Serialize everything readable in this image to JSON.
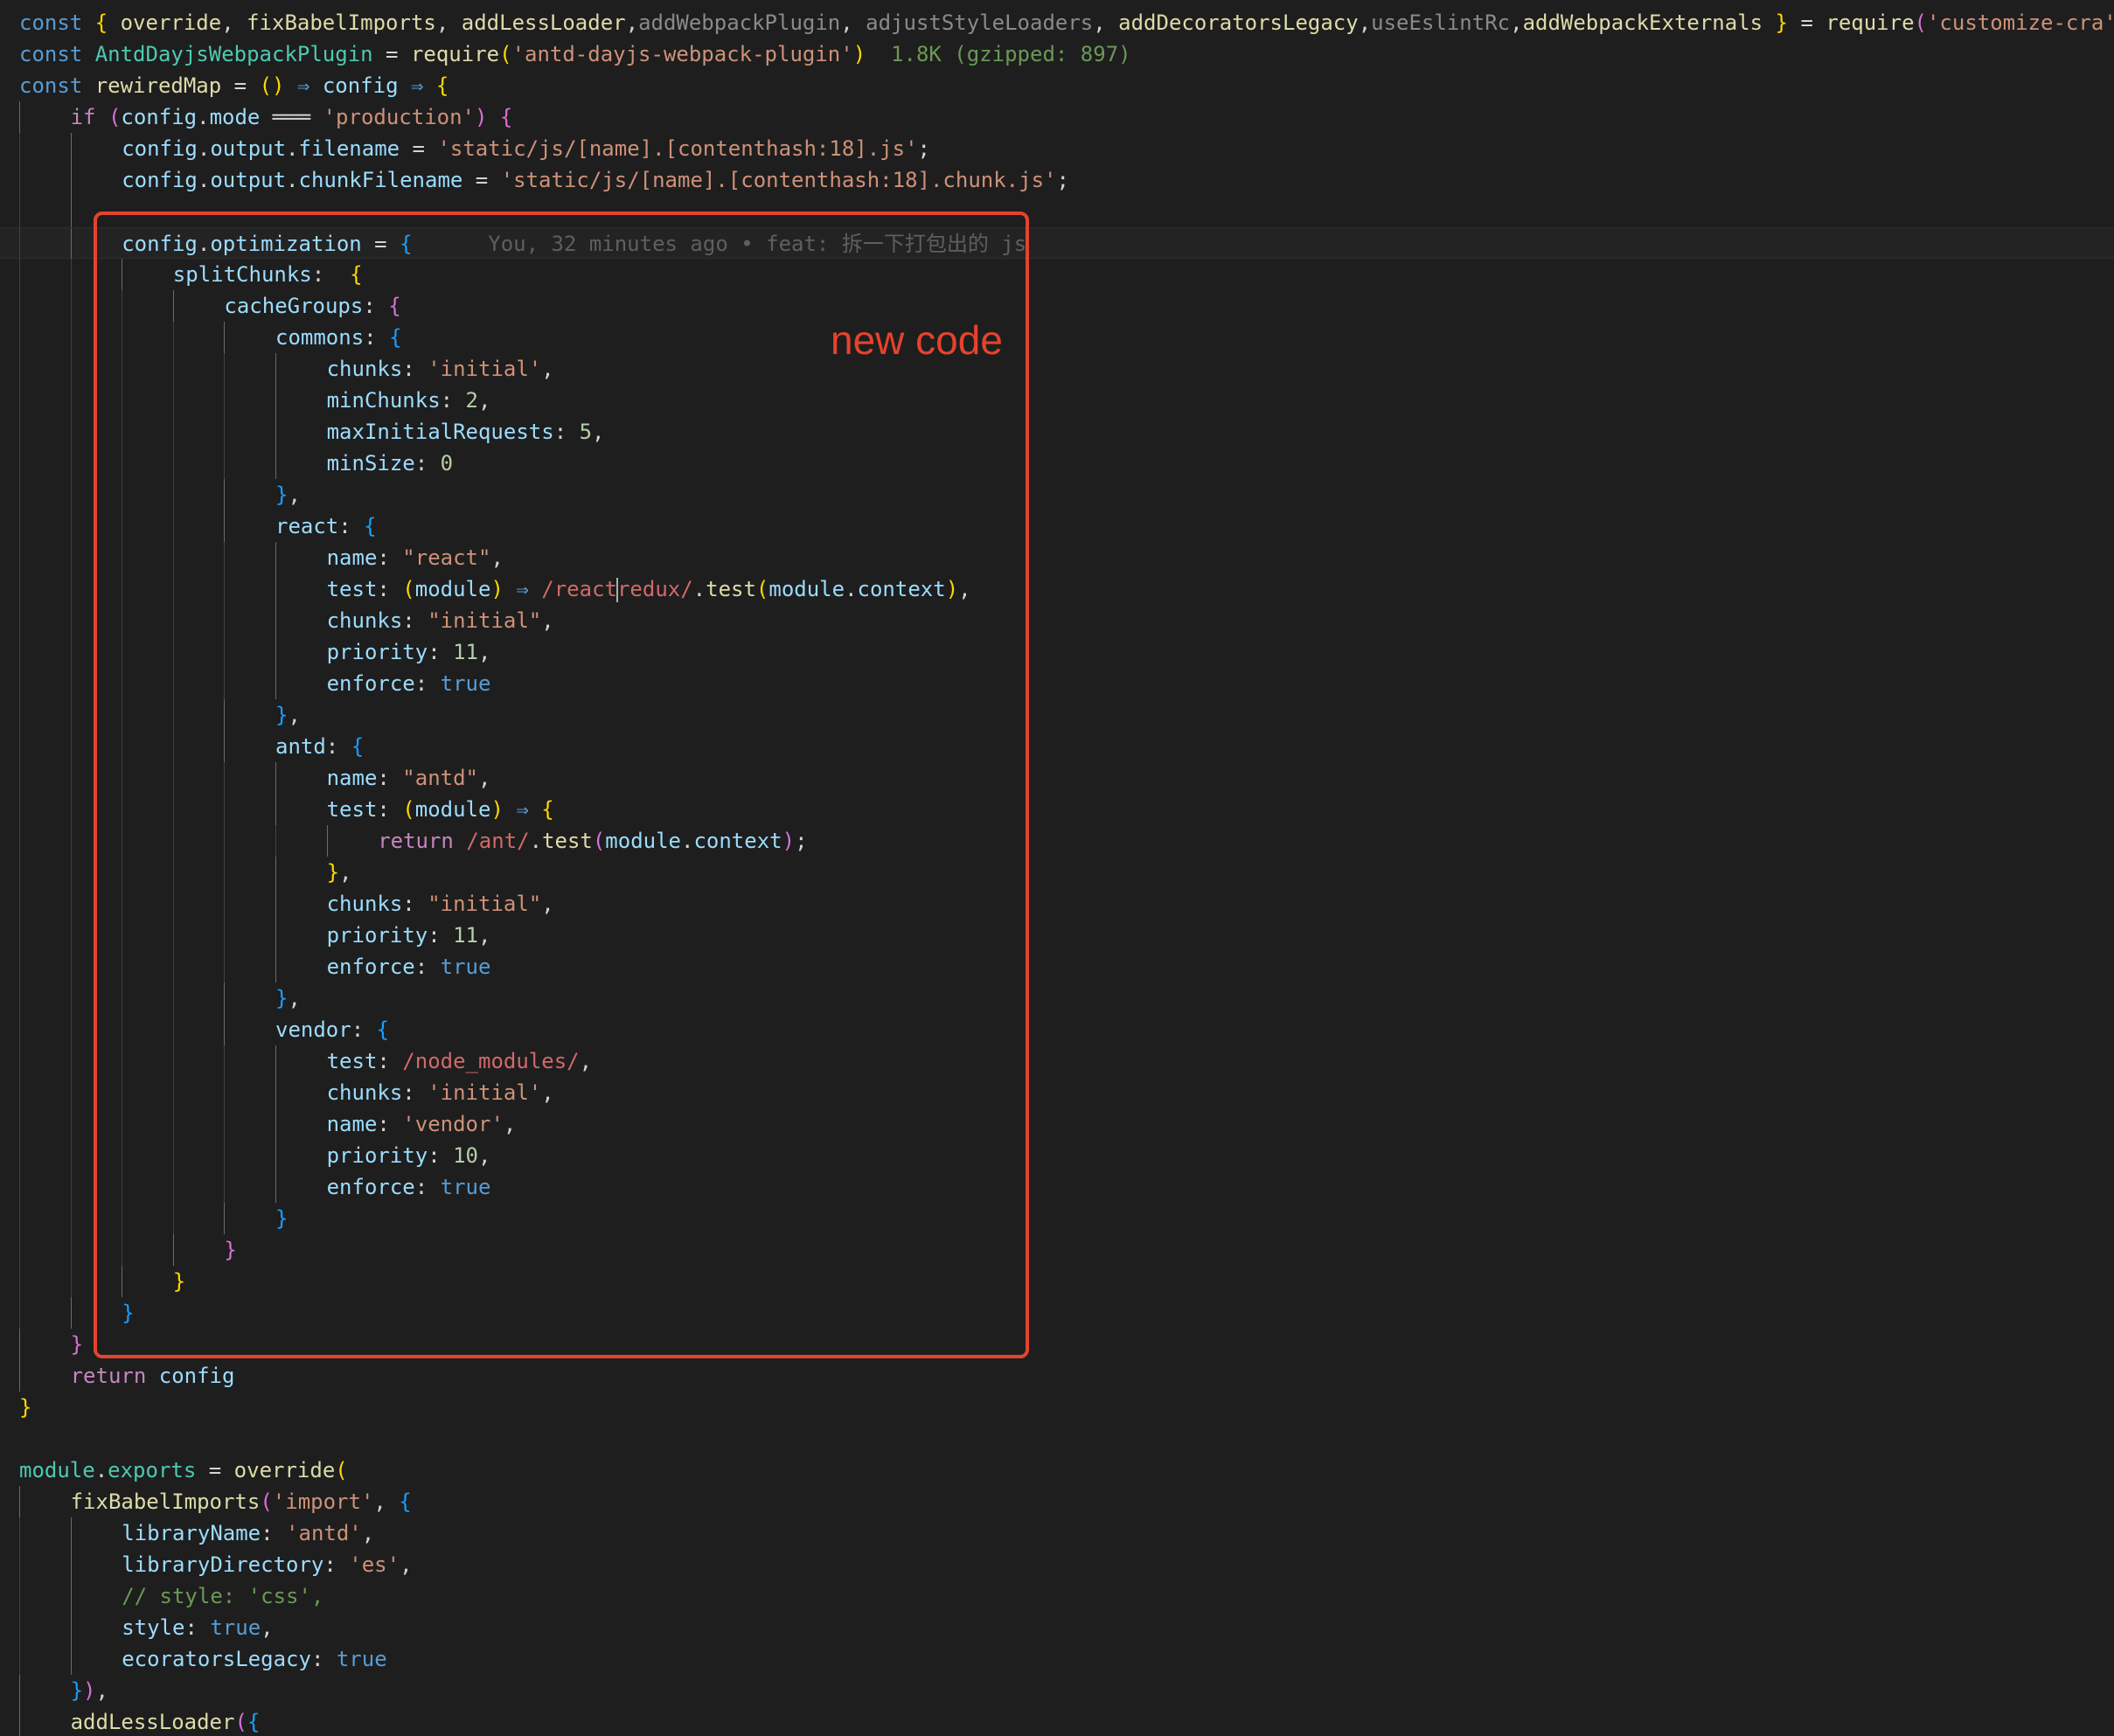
{
  "annotation": {
    "label": "new code",
    "color": "#e5432d"
  },
  "editor": {
    "background": "#1e1e1e",
    "lines": [
      {
        "indent": 0,
        "tokens": [
          [
            "keyword",
            "const "
          ],
          [
            "brace1",
            "{ "
          ],
          [
            "func",
            "override"
          ],
          [
            "punct",
            ", "
          ],
          [
            "func",
            "fixBabelImports"
          ],
          [
            "punct",
            ", "
          ],
          [
            "func",
            "addLessLoader"
          ],
          [
            "punct",
            ","
          ],
          [
            "dim",
            "addWebpackPlugin"
          ],
          [
            "punct",
            ", "
          ],
          [
            "dim",
            "adjustStyleLoaders"
          ],
          [
            "punct",
            ", "
          ],
          [
            "func",
            "addDecoratorsLegacy"
          ],
          [
            "punct",
            ","
          ],
          [
            "dim",
            "useEslintRc"
          ],
          [
            "punct",
            ","
          ],
          [
            "func",
            "addWebpackExternals"
          ],
          [
            "brace1",
            " }"
          ],
          [
            "punct",
            " = "
          ],
          [
            "func",
            "require"
          ],
          [
            "brace2",
            "("
          ],
          [
            "string",
            "'customize-cra'"
          ],
          [
            "brace2",
            ")"
          ]
        ]
      },
      {
        "indent": 0,
        "tokens": [
          [
            "keyword",
            "const "
          ],
          [
            "class",
            "AntdDayjsWebpackPlugin"
          ],
          [
            "punct",
            " = "
          ],
          [
            "func",
            "require"
          ],
          [
            "brace1",
            "("
          ],
          [
            "string",
            "'antd-dayjs-webpack-plugin'"
          ],
          [
            "brace1",
            ")"
          ],
          [
            "size",
            "  1.8K (gzipped: 897)"
          ]
        ]
      },
      {
        "indent": 0,
        "tokens": [
          [
            "keyword",
            "const "
          ],
          [
            "func",
            "rewiredMap"
          ],
          [
            "punct",
            " = "
          ],
          [
            "brace1",
            "()"
          ],
          [
            "keyword",
            " ⇒ "
          ],
          [
            "var",
            "config"
          ],
          [
            "keyword",
            " ⇒ "
          ],
          [
            "brace1",
            "{"
          ]
        ]
      },
      {
        "indent": 1,
        "tokens": [
          [
            "control",
            "if "
          ],
          [
            "brace2",
            "("
          ],
          [
            "var",
            "config"
          ],
          [
            "punct",
            "."
          ],
          [
            "var",
            "mode"
          ],
          [
            "punct",
            " ═══ "
          ],
          [
            "string",
            "'production'"
          ],
          [
            "brace2",
            ")"
          ],
          [
            "punct",
            " "
          ],
          [
            "brace2",
            "{"
          ]
        ]
      },
      {
        "indent": 2,
        "tokens": [
          [
            "var",
            "config"
          ],
          [
            "punct",
            "."
          ],
          [
            "var",
            "output"
          ],
          [
            "punct",
            "."
          ],
          [
            "var",
            "filename"
          ],
          [
            "punct",
            " = "
          ],
          [
            "string",
            "'static/js/[name].[contenthash:18].js'"
          ],
          [
            "punct",
            ";"
          ]
        ]
      },
      {
        "indent": 2,
        "tokens": [
          [
            "var",
            "config"
          ],
          [
            "punct",
            "."
          ],
          [
            "var",
            "output"
          ],
          [
            "punct",
            "."
          ],
          [
            "var",
            "chunkFilename"
          ],
          [
            "punct",
            " = "
          ],
          [
            "string",
            "'static/js/[name].[contenthash:18].chunk.js'"
          ],
          [
            "punct",
            ";"
          ]
        ]
      },
      {
        "indent": 2,
        "tokens": []
      },
      {
        "indent": 2,
        "current": true,
        "tokens": [
          [
            "var",
            "config"
          ],
          [
            "punct",
            "."
          ],
          [
            "var",
            "optimization"
          ],
          [
            "punct",
            " = "
          ],
          [
            "brace3",
            "{"
          ],
          [
            "blame",
            "      You, 32 minutes ago • feat: 拆一下打包出的 js"
          ]
        ]
      },
      {
        "indent": 3,
        "tokens": [
          [
            "var",
            "splitChunks"
          ],
          [
            "punct",
            ":  "
          ],
          [
            "brace1",
            "{"
          ]
        ]
      },
      {
        "indent": 4,
        "tokens": [
          [
            "var",
            "cacheGroups"
          ],
          [
            "punct",
            ": "
          ],
          [
            "brace2",
            "{"
          ]
        ]
      },
      {
        "indent": 5,
        "tokens": [
          [
            "var",
            "commons"
          ],
          [
            "punct",
            ": "
          ],
          [
            "brace3",
            "{"
          ]
        ]
      },
      {
        "indent": 6,
        "tokens": [
          [
            "var",
            "chunks"
          ],
          [
            "punct",
            ": "
          ],
          [
            "string",
            "'initial'"
          ],
          [
            "punct",
            ","
          ]
        ]
      },
      {
        "indent": 6,
        "tokens": [
          [
            "var",
            "minChunks"
          ],
          [
            "punct",
            ": "
          ],
          [
            "number",
            "2"
          ],
          [
            "punct",
            ","
          ]
        ]
      },
      {
        "indent": 6,
        "tokens": [
          [
            "var",
            "maxInitialRequests"
          ],
          [
            "punct",
            ": "
          ],
          [
            "number",
            "5"
          ],
          [
            "punct",
            ","
          ]
        ]
      },
      {
        "indent": 6,
        "tokens": [
          [
            "var",
            "minSize"
          ],
          [
            "punct",
            ": "
          ],
          [
            "number",
            "0"
          ]
        ]
      },
      {
        "indent": 5,
        "tokens": [
          [
            "brace3",
            "}"
          ],
          [
            "punct",
            ","
          ]
        ]
      },
      {
        "indent": 5,
        "tokens": [
          [
            "var",
            "react"
          ],
          [
            "punct",
            ": "
          ],
          [
            "brace3",
            "{"
          ]
        ]
      },
      {
        "indent": 6,
        "tokens": [
          [
            "var",
            "name"
          ],
          [
            "punct",
            ": "
          ],
          [
            "string",
            "\"react\""
          ],
          [
            "punct",
            ","
          ]
        ]
      },
      {
        "indent": 6,
        "tokens": [
          [
            "var",
            "test"
          ],
          [
            "punct",
            ": "
          ],
          [
            "brace1",
            "("
          ],
          [
            "var",
            "module"
          ],
          [
            "brace1",
            ")"
          ],
          [
            "keyword",
            " ⇒ "
          ],
          [
            "regex",
            "/react"
          ],
          [
            "caret",
            ""
          ],
          [
            "regex",
            "redux/"
          ],
          [
            "punct",
            "."
          ],
          [
            "func",
            "test"
          ],
          [
            "brace1",
            "("
          ],
          [
            "var",
            "module"
          ],
          [
            "punct",
            "."
          ],
          [
            "var",
            "context"
          ],
          [
            "brace1",
            ")"
          ],
          [
            "punct",
            ","
          ]
        ]
      },
      {
        "indent": 6,
        "tokens": [
          [
            "var",
            "chunks"
          ],
          [
            "punct",
            ": "
          ],
          [
            "string",
            "\"initial\""
          ],
          [
            "punct",
            ","
          ]
        ]
      },
      {
        "indent": 6,
        "tokens": [
          [
            "var",
            "priority"
          ],
          [
            "punct",
            ": "
          ],
          [
            "number",
            "11"
          ],
          [
            "punct",
            ","
          ]
        ]
      },
      {
        "indent": 6,
        "tokens": [
          [
            "var",
            "enforce"
          ],
          [
            "punct",
            ": "
          ],
          [
            "bool",
            "true"
          ]
        ]
      },
      {
        "indent": 5,
        "tokens": [
          [
            "brace3",
            "}"
          ],
          [
            "punct",
            ","
          ]
        ]
      },
      {
        "indent": 5,
        "tokens": [
          [
            "var",
            "antd"
          ],
          [
            "punct",
            ": "
          ],
          [
            "brace3",
            "{"
          ]
        ]
      },
      {
        "indent": 6,
        "tokens": [
          [
            "var",
            "name"
          ],
          [
            "punct",
            ": "
          ],
          [
            "string",
            "\"antd\""
          ],
          [
            "punct",
            ","
          ]
        ]
      },
      {
        "indent": 6,
        "tokens": [
          [
            "var",
            "test"
          ],
          [
            "punct",
            ": "
          ],
          [
            "brace1",
            "("
          ],
          [
            "var",
            "module"
          ],
          [
            "brace1",
            ")"
          ],
          [
            "keyword",
            " ⇒ "
          ],
          [
            "brace1",
            "{"
          ]
        ]
      },
      {
        "indent": 7,
        "tokens": [
          [
            "control",
            "return "
          ],
          [
            "regex",
            "/ant/"
          ],
          [
            "punct",
            "."
          ],
          [
            "func",
            "test"
          ],
          [
            "brace2",
            "("
          ],
          [
            "var",
            "module"
          ],
          [
            "punct",
            "."
          ],
          [
            "var",
            "context"
          ],
          [
            "brace2",
            ")"
          ],
          [
            "punct",
            ";"
          ]
        ]
      },
      {
        "indent": 6,
        "tokens": [
          [
            "brace1",
            "}"
          ],
          [
            "punct",
            ","
          ]
        ]
      },
      {
        "indent": 6,
        "tokens": [
          [
            "var",
            "chunks"
          ],
          [
            "punct",
            ": "
          ],
          [
            "string",
            "\"initial\""
          ],
          [
            "punct",
            ","
          ]
        ]
      },
      {
        "indent": 6,
        "tokens": [
          [
            "var",
            "priority"
          ],
          [
            "punct",
            ": "
          ],
          [
            "number",
            "11"
          ],
          [
            "punct",
            ","
          ]
        ]
      },
      {
        "indent": 6,
        "tokens": [
          [
            "var",
            "enforce"
          ],
          [
            "punct",
            ": "
          ],
          [
            "bool",
            "true"
          ]
        ]
      },
      {
        "indent": 5,
        "tokens": [
          [
            "brace3",
            "}"
          ],
          [
            "punct",
            ","
          ]
        ]
      },
      {
        "indent": 5,
        "tokens": [
          [
            "var",
            "vendor"
          ],
          [
            "punct",
            ": "
          ],
          [
            "brace3",
            "{"
          ]
        ]
      },
      {
        "indent": 6,
        "tokens": [
          [
            "var",
            "test"
          ],
          [
            "punct",
            ": "
          ],
          [
            "regex",
            "/node_modules/"
          ],
          [
            "punct",
            ","
          ]
        ]
      },
      {
        "indent": 6,
        "tokens": [
          [
            "var",
            "chunks"
          ],
          [
            "punct",
            ": "
          ],
          [
            "string",
            "'initial'"
          ],
          [
            "punct",
            ","
          ]
        ]
      },
      {
        "indent": 6,
        "tokens": [
          [
            "var",
            "name"
          ],
          [
            "punct",
            ": "
          ],
          [
            "string",
            "'vendor'"
          ],
          [
            "punct",
            ","
          ]
        ]
      },
      {
        "indent": 6,
        "tokens": [
          [
            "var",
            "priority"
          ],
          [
            "punct",
            ": "
          ],
          [
            "number",
            "10"
          ],
          [
            "punct",
            ","
          ]
        ]
      },
      {
        "indent": 6,
        "tokens": [
          [
            "var",
            "enforce"
          ],
          [
            "punct",
            ": "
          ],
          [
            "bool",
            "true"
          ]
        ]
      },
      {
        "indent": 5,
        "tokens": [
          [
            "brace3",
            "}"
          ]
        ]
      },
      {
        "indent": 4,
        "tokens": [
          [
            "brace2",
            "}"
          ]
        ]
      },
      {
        "indent": 3,
        "tokens": [
          [
            "brace1",
            "}"
          ]
        ]
      },
      {
        "indent": 2,
        "tokens": [
          [
            "brace3",
            "}"
          ]
        ]
      },
      {
        "indent": 1,
        "tokens": [
          [
            "brace2",
            "}"
          ]
        ]
      },
      {
        "indent": 1,
        "tokens": [
          [
            "control",
            "return "
          ],
          [
            "var",
            "config"
          ]
        ]
      },
      {
        "indent": 0,
        "tokens": [
          [
            "brace1",
            "}"
          ]
        ]
      },
      {
        "indent": 0,
        "tokens": []
      },
      {
        "indent": 0,
        "tokens": [
          [
            "class",
            "module"
          ],
          [
            "punct",
            "."
          ],
          [
            "class",
            "exports"
          ],
          [
            "punct",
            " = "
          ],
          [
            "func",
            "override"
          ],
          [
            "brace1",
            "("
          ]
        ]
      },
      {
        "indent": 1,
        "tokens": [
          [
            "func",
            "fixBabelImports"
          ],
          [
            "brace2",
            "("
          ],
          [
            "string",
            "'import'"
          ],
          [
            "punct",
            ", "
          ],
          [
            "brace3",
            "{"
          ]
        ]
      },
      {
        "indent": 2,
        "tokens": [
          [
            "var",
            "libraryName"
          ],
          [
            "punct",
            ": "
          ],
          [
            "string",
            "'antd'"
          ],
          [
            "punct",
            ","
          ]
        ]
      },
      {
        "indent": 2,
        "tokens": [
          [
            "var",
            "libraryDirectory"
          ],
          [
            "punct",
            ": "
          ],
          [
            "string",
            "'es'"
          ],
          [
            "punct",
            ","
          ]
        ]
      },
      {
        "indent": 2,
        "tokens": [
          [
            "comment",
            "// style: 'css',"
          ]
        ]
      },
      {
        "indent": 2,
        "tokens": [
          [
            "var",
            "style"
          ],
          [
            "punct",
            ": "
          ],
          [
            "bool",
            "true"
          ],
          [
            "punct",
            ","
          ]
        ]
      },
      {
        "indent": 2,
        "tokens": [
          [
            "var",
            "ecoratorsLegacy"
          ],
          [
            "punct",
            ": "
          ],
          [
            "bool",
            "true"
          ]
        ]
      },
      {
        "indent": 1,
        "tokens": [
          [
            "brace3",
            "}"
          ],
          [
            "brace2",
            ")"
          ],
          [
            "punct",
            ","
          ]
        ]
      },
      {
        "indent": 1,
        "tokens": [
          [
            "func",
            "addLessLoader"
          ],
          [
            "brace2",
            "("
          ],
          [
            "brace3",
            "{"
          ]
        ]
      }
    ]
  }
}
